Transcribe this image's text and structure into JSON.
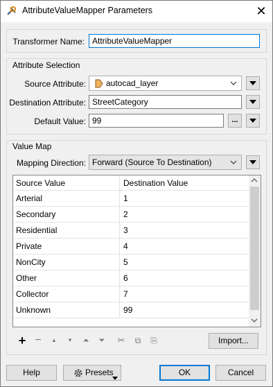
{
  "window": {
    "title": "AttributeValueMapper Parameters",
    "close_glyph": "✕"
  },
  "transformer": {
    "label": "Transformer Name:",
    "value": "AttributeValueMapper"
  },
  "attribute_selection": {
    "group_title": "Attribute Selection",
    "source_label": "Source Attribute:",
    "source_value": "autocad_layer",
    "destination_label": "Destination Attribute:",
    "destination_value": "StreetCategory",
    "default_label": "Default Value:",
    "default_value": "99",
    "ellipsis": "..."
  },
  "value_map": {
    "group_title": "Value Map",
    "direction_label": "Mapping Direction:",
    "direction_value": "Forward (Source To Destination)",
    "columns": [
      "Source Value",
      "Destination Value"
    ],
    "rows": [
      [
        "Arterial",
        "1"
      ],
      [
        "Secondary",
        "2"
      ],
      [
        "Residential",
        "3"
      ],
      [
        "Private",
        "4"
      ],
      [
        "NonCity",
        "5"
      ],
      [
        "Other",
        "6"
      ],
      [
        "Collector",
        "7"
      ],
      [
        "Unknown",
        "99"
      ]
    ],
    "toolbar": {
      "add": "+",
      "remove": "−",
      "move_up": "▲",
      "move_down": "▼",
      "move_top": "⏶",
      "move_bottom": "⏷",
      "cut": "✂",
      "copy": "⧉",
      "paste": "⎘"
    },
    "import_label": "Import..."
  },
  "footer": {
    "help_label": "Help",
    "presets_label": "Presets",
    "ok_label": "OK",
    "cancel_label": "Cancel"
  },
  "colors": {
    "accent": "#0078d7",
    "window_bg": "#f0f0f0"
  }
}
